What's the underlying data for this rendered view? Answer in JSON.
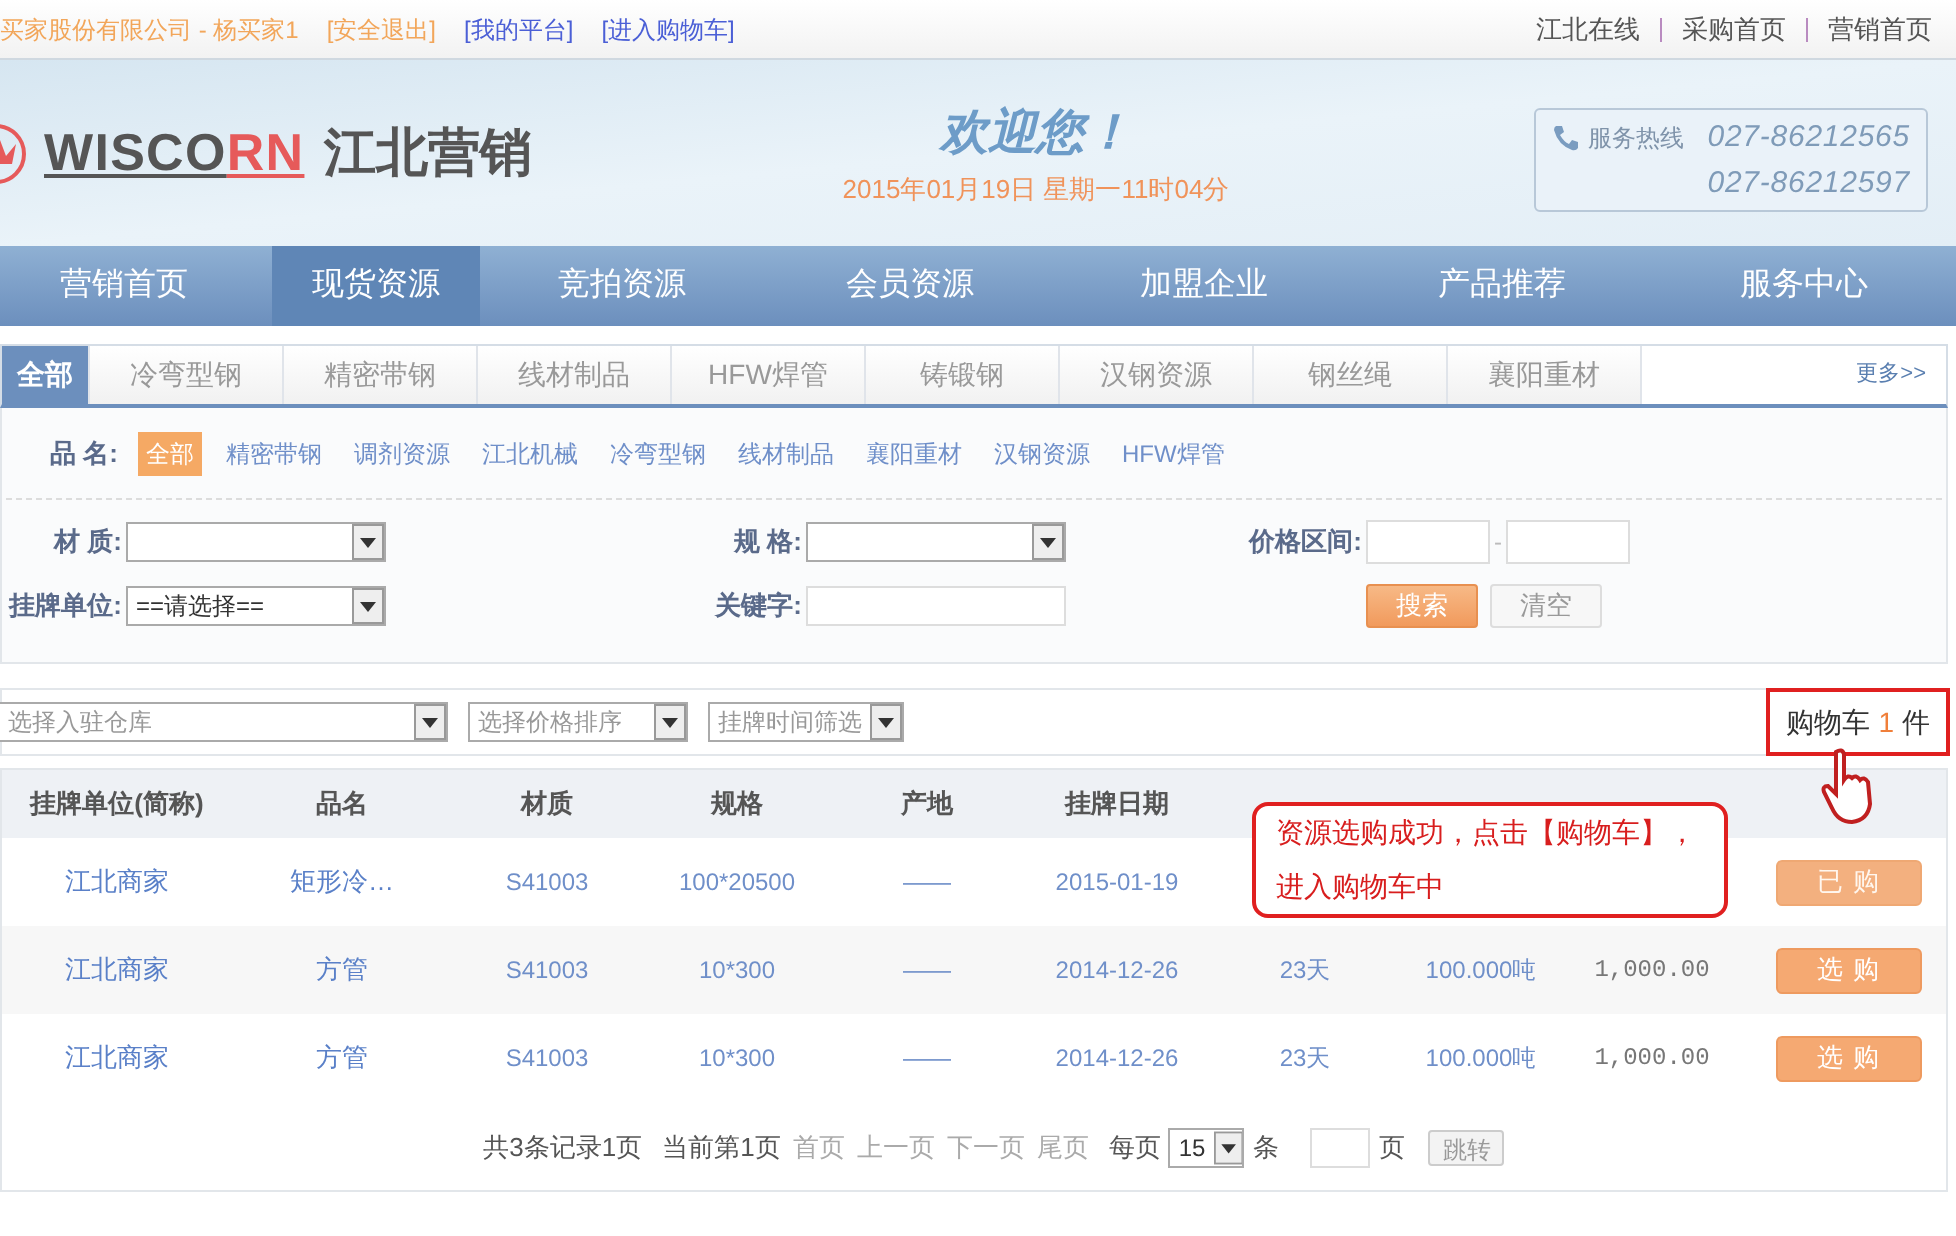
{
  "top_bar": {
    "user": "买家股份有限公司 - 杨买家1",
    "links": [
      {
        "label": "[安全退出]",
        "kind": "logout"
      },
      {
        "label": "[我的平台]",
        "kind": "nav"
      },
      {
        "label": "[进入购物车]",
        "kind": "nav"
      }
    ],
    "right_links": [
      "江北在线",
      "采购首页",
      "营销首页"
    ]
  },
  "header": {
    "logo": {
      "main": "WISCO",
      "accent": "RN",
      "cn": "江北营销"
    },
    "welcome": "欢迎您！",
    "datetime": "2015年01月19日 星期一11时04分",
    "hotline": {
      "label": "服务热线",
      "numbers": [
        "027-86212565",
        "027-86212597"
      ]
    }
  },
  "nav": [
    {
      "label": "营销首页",
      "selected": false
    },
    {
      "label": "现货资源",
      "selected": true
    },
    {
      "label": "竞拍资源",
      "selected": false
    },
    {
      "label": "会员资源",
      "selected": false
    },
    {
      "label": "加盟企业",
      "selected": false
    },
    {
      "label": "产品推荐",
      "selected": false
    },
    {
      "label": "服务中心",
      "selected": false
    }
  ],
  "category_tabs": [
    {
      "label": "全部",
      "selected": true
    },
    {
      "label": "冷弯型钢",
      "selected": false
    },
    {
      "label": "精密带钢",
      "selected": false
    },
    {
      "label": "线材制品",
      "selected": false
    },
    {
      "label": "HFW焊管",
      "selected": false
    },
    {
      "label": "铸锻钢",
      "selected": false
    },
    {
      "label": "汉钢资源",
      "selected": false
    },
    {
      "label": "钢丝绳",
      "selected": false
    },
    {
      "label": "襄阳重材",
      "selected": false
    }
  ],
  "more": "更多>>",
  "filter": {
    "product_label": "品 名:",
    "products": [
      {
        "label": "全部",
        "selected": true
      },
      {
        "label": "精密带钢",
        "selected": false
      },
      {
        "label": "调剂资源",
        "selected": false
      },
      {
        "label": "江北机械",
        "selected": false
      },
      {
        "label": "冷弯型钢",
        "selected": false
      },
      {
        "label": "线材制品",
        "selected": false
      },
      {
        "label": "襄阳重材",
        "selected": false
      },
      {
        "label": "汉钢资源",
        "selected": false
      },
      {
        "label": "HFW焊管",
        "selected": false
      }
    ],
    "fields": [
      {
        "label": "材 质:",
        "kind": "select"
      },
      {
        "label": "规 格:",
        "kind": "select"
      },
      {
        "label": "价格区间:",
        "kind": "range",
        "separator": "-"
      },
      {
        "label": "挂牌单位:",
        "kind": "select",
        "value": "==请选择=="
      },
      {
        "label": "关键字:",
        "kind": "text"
      },
      {
        "kind": "buttons",
        "buttons": [
          {
            "label": "搜索",
            "kind": "primary"
          },
          {
            "label": "清空",
            "kind": "secondary"
          }
        ]
      }
    ]
  },
  "toolbar": {
    "selects": [
      "选择入驻仓库",
      "选择价格排序",
      "挂牌时间筛选"
    ],
    "cart": {
      "label": "购物车",
      "count": "1",
      "unit": "件"
    }
  },
  "table": {
    "columns": [
      "挂牌单位(简称)",
      "品名",
      "材质",
      "规格",
      "产地",
      "挂牌日期"
    ],
    "rows": [
      {
        "cells": [
          "江北商家",
          "矩形冷…",
          "S41003",
          "100*20500",
          "——",
          "2015-01-19"
        ],
        "action": {
          "label": "已 购",
          "purchased": true
        }
      },
      {
        "cells": [
          "江北商家",
          "方管",
          "S41003",
          "10*300",
          "——",
          "2014-12-26",
          "23天",
          "100.000吨",
          "1,000.00"
        ],
        "action": {
          "label": "选 购",
          "purchased": false
        }
      },
      {
        "cells": [
          "江北商家",
          "方管",
          "S41003",
          "10*300",
          "——",
          "2014-12-26",
          "23天",
          "100.000吨",
          "1,000.00"
        ],
        "action": {
          "label": "选 购",
          "purchased": false
        }
      }
    ]
  },
  "pagination": {
    "summary": "共3条记录1页",
    "current": "当前第1页",
    "links": [
      "首页",
      "上一页",
      "下一页",
      "尾页"
    ],
    "per_page_label": "每页",
    "per_page": "15",
    "per_page_unit": "条",
    "page_unit": "页",
    "jump": "跳转"
  },
  "tooltip": {
    "lines": [
      "资源选购成功，点击【购物车】，",
      "进入购物车中"
    ]
  }
}
